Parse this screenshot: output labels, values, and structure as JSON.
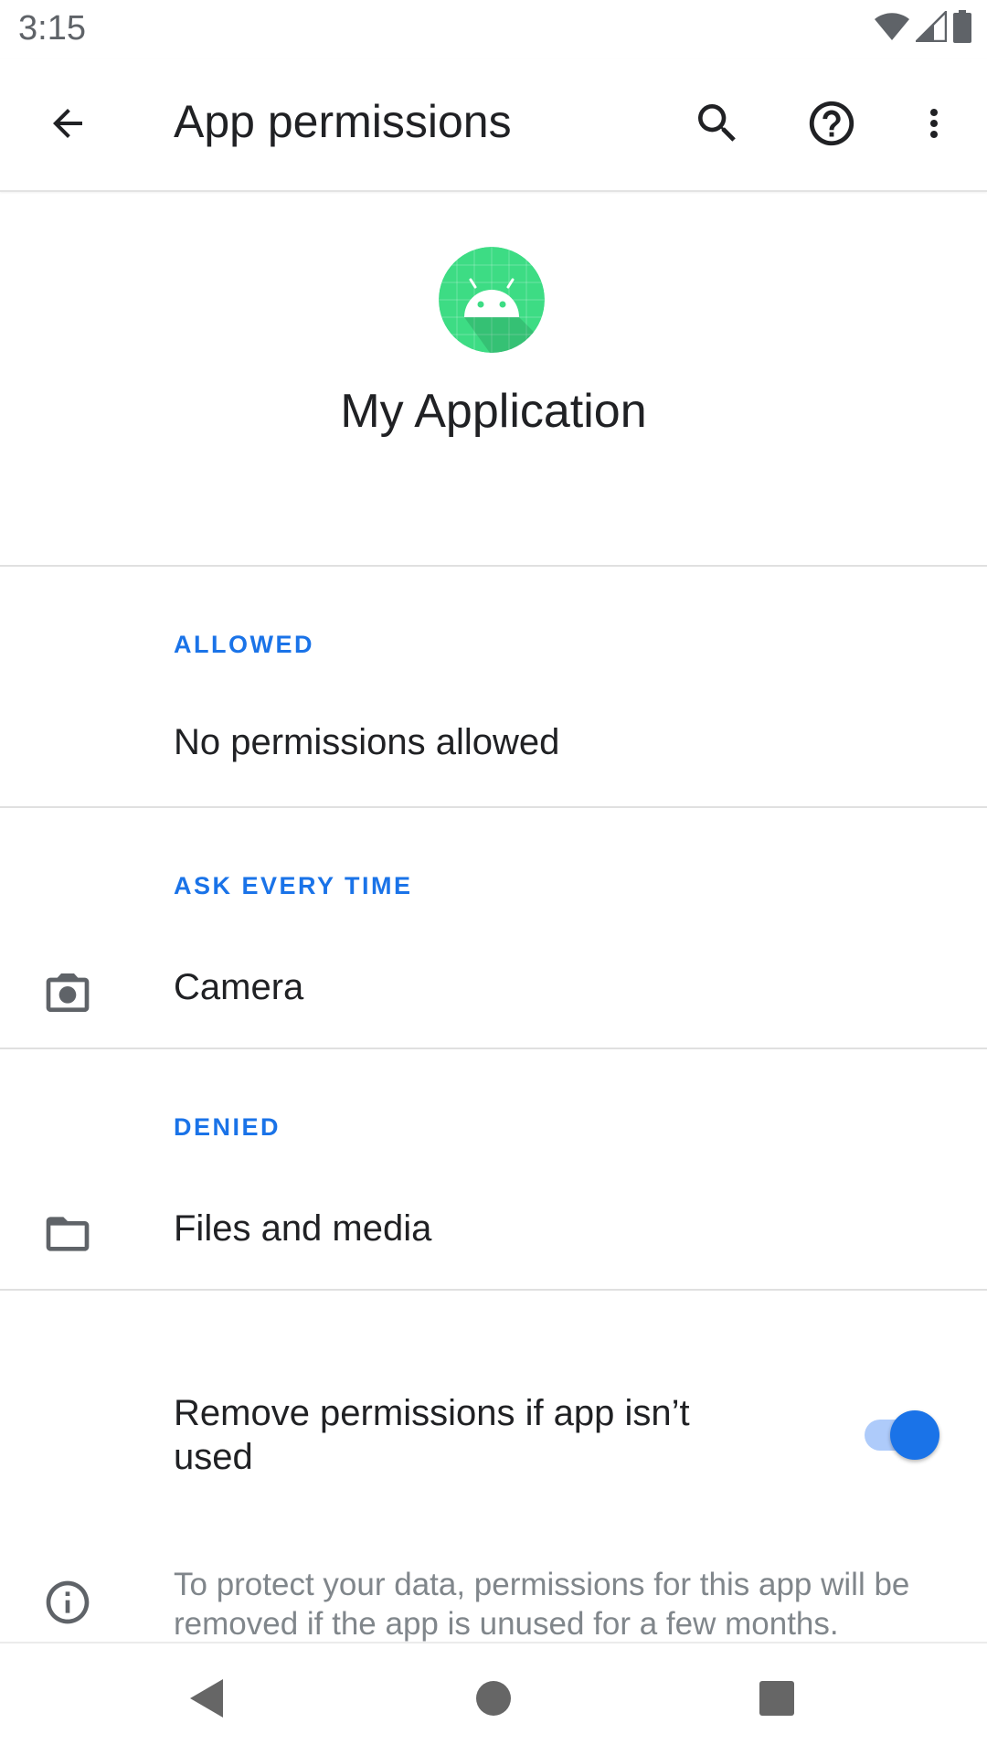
{
  "status_bar": {
    "time": "3:15",
    "icons": [
      "wifi-icon",
      "cell-signal-icon",
      "battery-icon"
    ]
  },
  "toolbar": {
    "title": "App permissions",
    "icons": [
      "back-arrow-icon",
      "search-icon",
      "help-icon",
      "more-vert-icon"
    ]
  },
  "app": {
    "name": "My Application",
    "icon": "android-app-icon",
    "icon_color": "#3ddc84"
  },
  "sections": {
    "allowed": {
      "label": "ALLOWED",
      "empty_text": "No permissions allowed"
    },
    "ask_every_time": {
      "label": "ASK EVERY TIME",
      "items": [
        {
          "label": "Camera",
          "icon": "camera-icon"
        }
      ]
    },
    "denied": {
      "label": "DENIED",
      "items": [
        {
          "label": "Files and media",
          "icon": "folder-icon"
        }
      ]
    }
  },
  "auto_revoke": {
    "label": "Remove permissions if app isn’t used",
    "enabled": true,
    "info_text": "To protect your data, permissions for this app will be removed if the app is unused for a few months."
  },
  "nav_bar": {
    "icons": [
      "nav-back-icon",
      "nav-home-icon",
      "nav-recents-icon"
    ]
  },
  "colors": {
    "accent": "#1a73e8",
    "toggle_track": "#aecbfa",
    "text_primary": "#202124",
    "text_secondary": "#80868b"
  }
}
